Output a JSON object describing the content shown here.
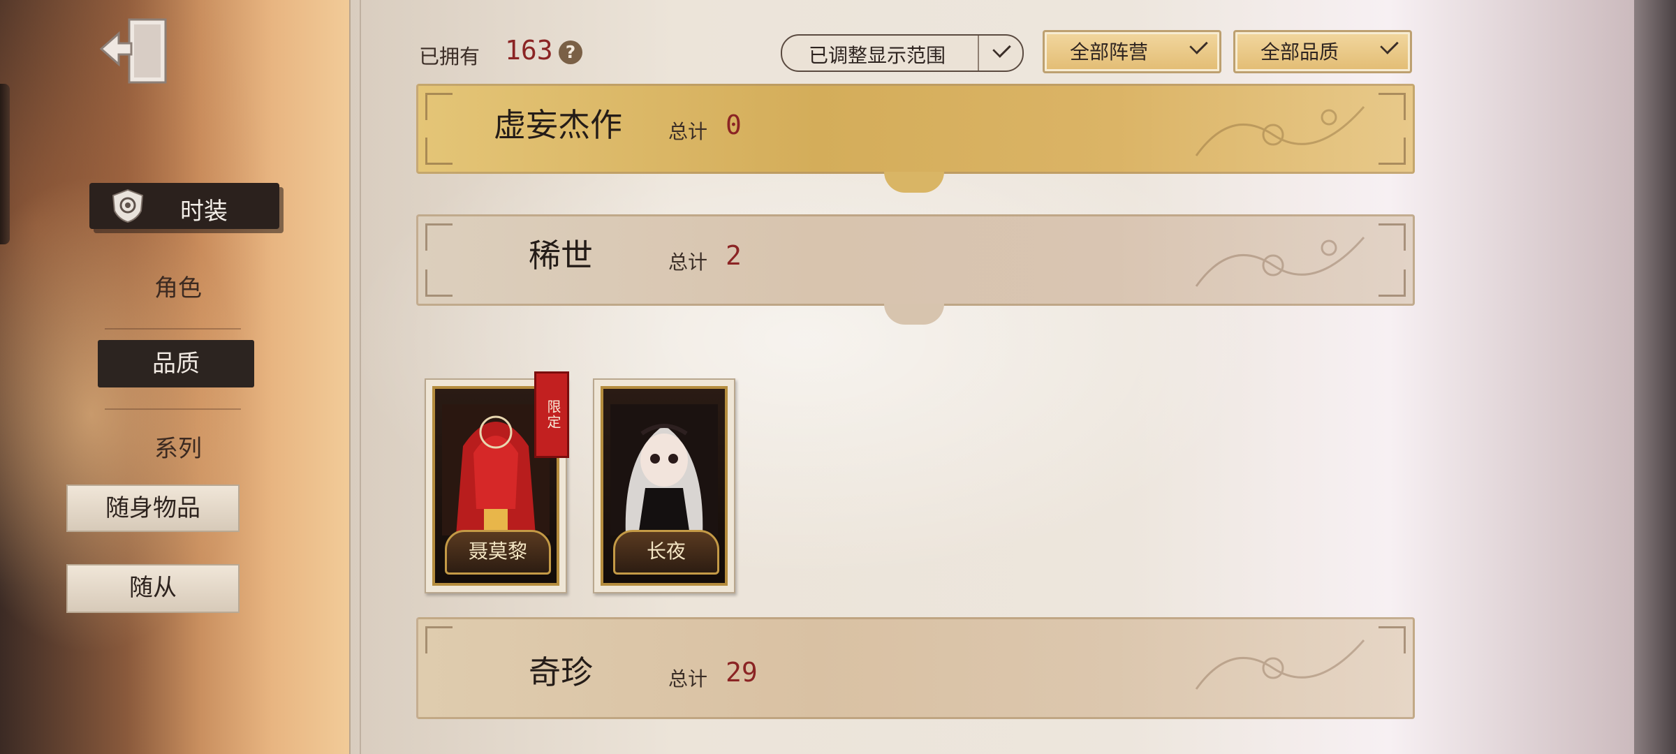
{
  "header": {
    "owned_label": "已拥有",
    "owned_count": "163",
    "help_icon": "question-icon",
    "filters": {
      "range": "已调整显示范围",
      "camp": "全部阵营",
      "quality": "全部品质"
    }
  },
  "sidebar": {
    "exit_icon": "exit-door-icon",
    "costume": "时装",
    "role": "角色",
    "quality": "品质",
    "series": "系列",
    "accessory": "随身物品",
    "follower": "随从"
  },
  "sections": [
    {
      "name": "虚妄杰作",
      "total_label": "总计",
      "total": "0"
    },
    {
      "name": "稀世",
      "total_label": "总计",
      "total": "2"
    },
    {
      "name": "奇珍",
      "total_label": "总计",
      "total": "29"
    }
  ],
  "cards": [
    {
      "name": "聂莫黎",
      "badge": "限定"
    },
    {
      "name": "长夜"
    }
  ],
  "colors": {
    "accent_red": "#8b2424",
    "gold_bar": "#d4ad5a",
    "sidebar_active": "#2b211d"
  }
}
